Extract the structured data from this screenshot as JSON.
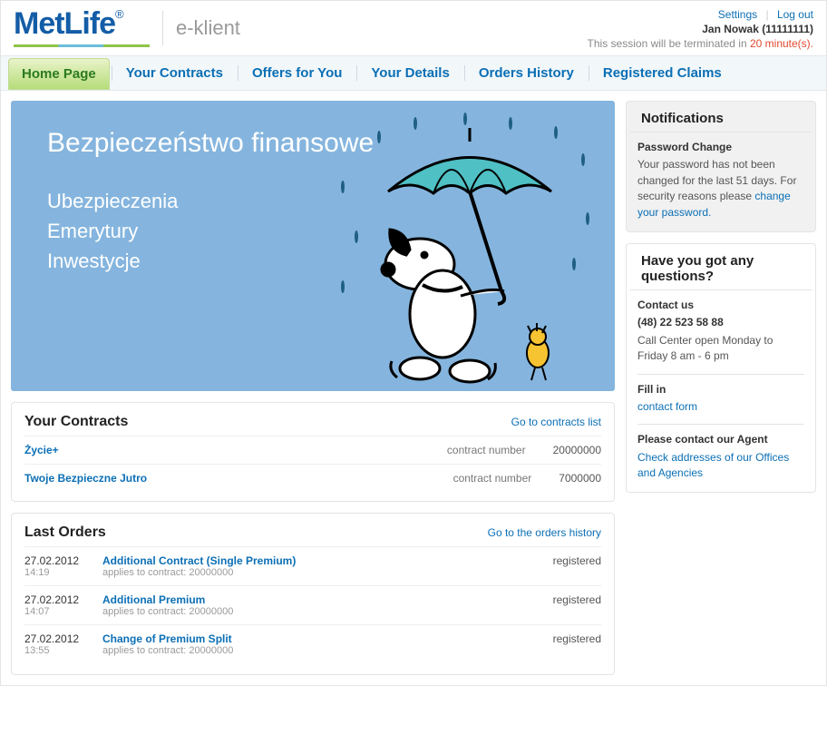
{
  "header": {
    "brand": "MetLife",
    "brand_reg": "®",
    "subbrand": "e-klient",
    "settings_label": "Settings",
    "logout_label": "Log out",
    "user_display": "Jan Nowak (11111111)",
    "session_prefix": "This session will be terminated in ",
    "session_time": "20 minute(s)."
  },
  "nav": [
    {
      "label": "Home Page",
      "active": true
    },
    {
      "label": "Your Contracts",
      "active": false
    },
    {
      "label": "Offers for You",
      "active": false
    },
    {
      "label": "Your Details",
      "active": false
    },
    {
      "label": "Orders History",
      "active": false
    },
    {
      "label": "Registered Claims",
      "active": false
    }
  ],
  "banner": {
    "headline": "Bezpieczeństwo finansowe",
    "lines": [
      "Ubezpieczenia",
      "Emerytury",
      "Inwestycje"
    ]
  },
  "contracts_panel": {
    "title": "Your Contracts",
    "link": "Go to contracts list",
    "col_label": "contract number",
    "rows": [
      {
        "name": "Życie+",
        "number": "20000000"
      },
      {
        "name": "Twoje Bezpieczne Jutro",
        "number": "7000000"
      }
    ]
  },
  "orders_panel": {
    "title": "Last Orders",
    "link": "Go to the orders history",
    "applies_prefix": "applies to contract: ",
    "rows": [
      {
        "date": "27.02.2012",
        "time": "14:19",
        "title": "Additional Contract (Single Premium)",
        "contract": "20000000",
        "status": "registered"
      },
      {
        "date": "27.02.2012",
        "time": "14:07",
        "title": "Additional Premium",
        "contract": "20000000",
        "status": "registered"
      },
      {
        "date": "27.02.2012",
        "time": "13:55",
        "title": "Change of Premium Split",
        "contract": "20000000",
        "status": "registered"
      }
    ]
  },
  "sidebar": {
    "notifications": {
      "title": "Notifications",
      "sub_title": "Password Change",
      "text": "Your password has not been changed for the last 51 days. For security reasons please ",
      "link": "change your password."
    },
    "questions": {
      "title": "Have you got any questions?",
      "contact_label": "Contact us",
      "phone": "(48) 22 523 58 88",
      "hours": "Call Center open Monday to Friday 8 am - 6 pm",
      "fill_label": "Fill in",
      "fill_link": "contact form",
      "agent_label": "Please contact our Agent",
      "agent_link": "Check addresses of our Offices and Agencies"
    }
  }
}
